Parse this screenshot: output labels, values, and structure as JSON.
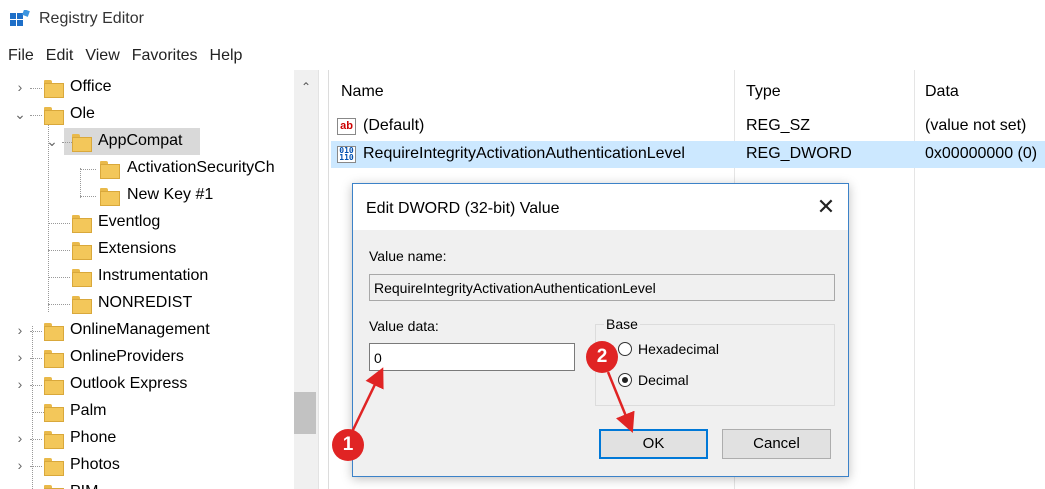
{
  "window": {
    "title": "Registry Editor"
  },
  "menu": [
    "File",
    "Edit",
    "View",
    "Favorites",
    "Help"
  ],
  "tree": {
    "items": [
      {
        "label": "Office",
        "expander": "›"
      },
      {
        "label": "Ole",
        "expander": "⌄"
      },
      {
        "label": "AppCompat",
        "expander": "⌄",
        "selected": true
      },
      {
        "label": "ActivationSecurityCh"
      },
      {
        "label": "New Key #1"
      },
      {
        "label": "Eventlog"
      },
      {
        "label": "Extensions"
      },
      {
        "label": "Instrumentation"
      },
      {
        "label": "NONREDIST"
      },
      {
        "label": "OnlineManagement",
        "expander": "›"
      },
      {
        "label": "OnlineProviders",
        "expander": "›"
      },
      {
        "label": "Outlook Express",
        "expander": "›"
      },
      {
        "label": "Palm"
      },
      {
        "label": "Phone",
        "expander": "›"
      },
      {
        "label": "Photos",
        "expander": "›"
      },
      {
        "label": "PIM",
        "expander": "›"
      }
    ]
  },
  "list": {
    "columns": [
      "Name",
      "Type",
      "Data"
    ],
    "rows": [
      {
        "icon": "string-value-icon",
        "name": "(Default)",
        "type": "REG_SZ",
        "data": "(value not set)"
      },
      {
        "icon": "dword-value-icon",
        "name": "RequireIntegrityActivationAuthenticationLevel",
        "type": "REG_DWORD",
        "data": "0x00000000 (0)",
        "selected": true
      }
    ]
  },
  "dialog": {
    "title": "Edit DWORD (32-bit) Value",
    "value_name_label": "Value name:",
    "value_name": "RequireIntegrityActivationAuthenticationLevel",
    "value_data_label": "Value data:",
    "value_data": "0",
    "base_label": "Base",
    "base_options": [
      {
        "label": "Hexadecimal",
        "selected": false
      },
      {
        "label": "Decimal",
        "selected": true
      }
    ],
    "ok_label": "OK",
    "cancel_label": "Cancel"
  },
  "annotations": {
    "step1": "1",
    "step2": "2",
    "color": "#e02424"
  },
  "colors": {
    "selection": "#cce8ff",
    "accent": "#0078d7"
  }
}
